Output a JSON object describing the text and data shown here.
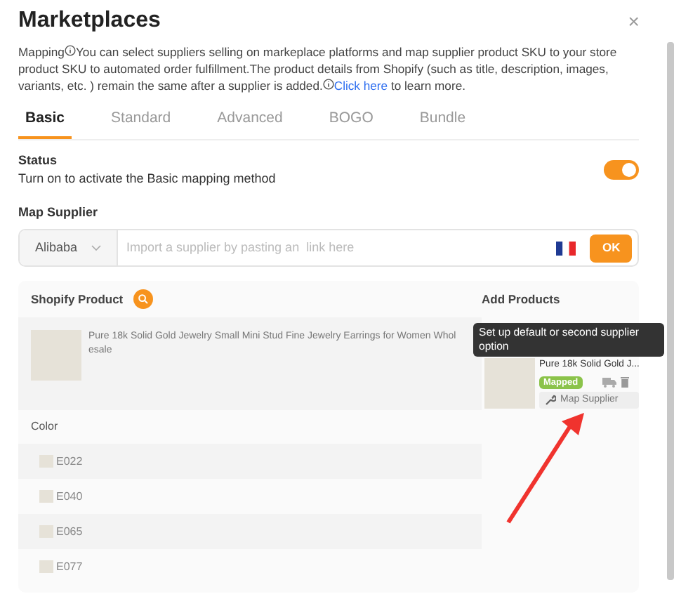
{
  "dialog": {
    "title": "Marketplaces",
    "close": "×"
  },
  "intro": {
    "lead": "Mapping",
    "text": "You can select suppliers selling on markeplace platforms and map supplier product SKU to your store product SKU to automated order fulfillment.The product details from Shopify (such as title, description, images, variants, etc. ) remain the same after a supplier is added.",
    "link": "Click here",
    "tail": " to learn more."
  },
  "tabs": [
    {
      "label": "Basic",
      "selected": true
    },
    {
      "label": "Standard",
      "selected": false
    },
    {
      "label": "Advanced",
      "selected": false
    },
    {
      "label": "BOGO",
      "selected": false
    },
    {
      "label": "Bundle",
      "selected": false
    }
  ],
  "status": {
    "title": "Status",
    "description": "Turn on to activate the Basic mapping method",
    "on": true
  },
  "map_supplier": {
    "title": "Map Supplier",
    "platform": "Alibaba",
    "placeholder": "Import a supplier by pasting an  link here",
    "button": "OK"
  },
  "product_panel": {
    "shopify_heading": "Shopify Product",
    "add_heading": "Add Products",
    "product_title": "Pure 18k Solid Gold Jewelry Small Mini Stud Fine Jewelry Earrings for Women Wholesale",
    "supplier": {
      "name": "Pure 18k Solid Gold J...",
      "badge": "Mapped",
      "button": "Map Supplier"
    },
    "tooltip": "Set up default or second supplier option",
    "variant_heading": "Color",
    "variants": [
      {
        "label": "E022"
      },
      {
        "label": "E040"
      },
      {
        "label": "E065"
      },
      {
        "label": "E077"
      }
    ]
  }
}
